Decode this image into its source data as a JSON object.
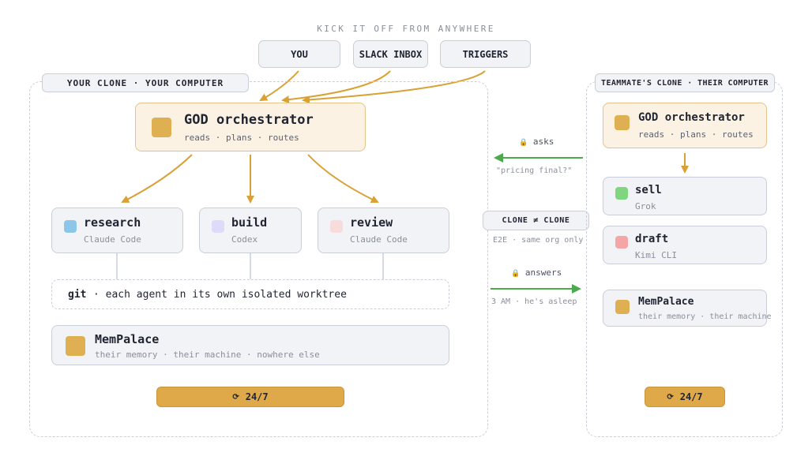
{
  "header": {
    "caption": "KICK IT OFF FROM ANYWHERE"
  },
  "inputs": [
    {
      "label": "YOU"
    },
    {
      "label": "SLACK INBOX"
    },
    {
      "label": "TRIGGERS"
    }
  ],
  "your_clone": {
    "label": "YOUR CLONE · YOUR COMPUTER",
    "orchestrator": {
      "title": "GOD orchestrator",
      "subtitle": "reads · plans · routes"
    },
    "agents": [
      {
        "title": "research",
        "subtitle": "Claude Code",
        "color": "#8cc6e8"
      },
      {
        "title": "build",
        "subtitle": "Codex",
        "color": "#dcdcfa"
      },
      {
        "title": "review",
        "subtitle": "Claude Code",
        "color": "#f8dcdc"
      }
    ],
    "git": {
      "keyword": "git",
      "text": "· each agent in its own isolated worktree"
    },
    "memory": {
      "title": "MemPalace",
      "subtitle": "their memory · their machine · nowhere else"
    },
    "uptime": {
      "icon": "⟳",
      "label": "24/7"
    }
  },
  "middle": {
    "asks": {
      "icon": "🔒",
      "label": "asks",
      "quote": "\"pricing final?\""
    },
    "clone_label": "CLONE ≠ CLONE",
    "clone_sub": "E2E · same org only",
    "answers": {
      "icon": "🔒",
      "label": "answers",
      "note": "3 AM · he's asleep"
    }
  },
  "teammate_clone": {
    "label": "TEAMMATE'S CLONE · THEIR COMPUTER",
    "orchestrator": {
      "title": "GOD orchestrator",
      "subtitle": "reads · plans · routes"
    },
    "agents": [
      {
        "title": "sell",
        "subtitle": "Grok",
        "color": "#7fd67f"
      },
      {
        "title": "draft",
        "subtitle": "Kimi CLI",
        "color": "#f4a6a6"
      }
    ],
    "memory": {
      "title": "MemPalace",
      "subtitle": "their memory · their machine"
    },
    "uptime": {
      "icon": "⟳",
      "label": "24/7"
    }
  },
  "colors": {
    "accent": "#dfa94a",
    "arrow_orange": "#d9a033",
    "arrow_green": "#4caa4c",
    "card_bg": "#f1f3f7",
    "orch_bg": "#fcf2e3",
    "memory_square": "#dfb052",
    "orch_square": "#dfb052"
  },
  "icons": {
    "lock": "lock-icon",
    "refresh": "refresh-icon",
    "arrow": "arrow-icon"
  }
}
